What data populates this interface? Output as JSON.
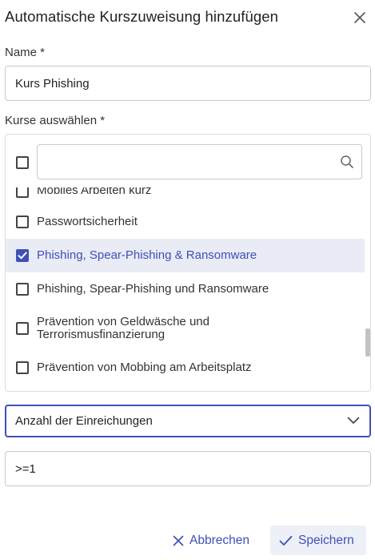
{
  "dialog": {
    "title": "Automatische Kurszuweisung hinzufügen"
  },
  "name_field": {
    "label": "Name *",
    "value": "Kurs Phishing"
  },
  "courses_field": {
    "label": "Kurse auswählen *",
    "search_value": "",
    "items": [
      {
        "label": "Mobiles Arbeiten kurz",
        "checked": false
      },
      {
        "label": "Passwortsicherheit",
        "checked": false
      },
      {
        "label": "Phishing, Spear-Phishing & Ransomware",
        "checked": true
      },
      {
        "label": "Phishing, Spear-Phishing und Ransomware",
        "checked": false
      },
      {
        "label": "Prävention von Geldwäsche und",
        "label_line2": "Terrorismusfinanzierung",
        "checked": false
      },
      {
        "label": "Prävention von Mobbing am Arbeitsplatz",
        "checked": false
      }
    ]
  },
  "criteria_select": {
    "selected": "Anzahl der Einreichungen"
  },
  "criteria_value": {
    "value": ">=1"
  },
  "footer": {
    "cancel_label": "Abbrechen",
    "save_label": "Speichern"
  },
  "colors": {
    "accent": "#3f51b5",
    "selected_row": "#e9ebf5",
    "save_bg": "#eef0f7"
  },
  "icons": [
    "close-icon",
    "search-icon",
    "chevron-down-icon",
    "check-icon"
  ]
}
